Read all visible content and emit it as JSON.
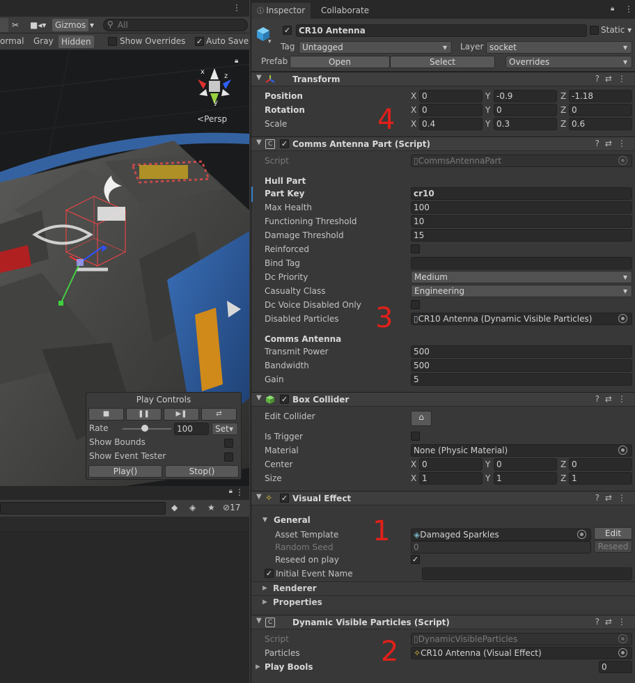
{
  "scene": {
    "gizmos": "Gizmos",
    "search_placeholder": "All",
    "shading": [
      "ormal",
      "Gray",
      "Hidden"
    ],
    "show_overrides": "Show Overrides",
    "auto_save": "Auto Save",
    "persp": "Persp",
    "axes": {
      "x": "x",
      "y": "y",
      "z": "z"
    },
    "hidden_count": "17"
  },
  "play_controls": {
    "title": "Play Controls",
    "rate_label": "Rate",
    "rate_value": "100",
    "set": "Set",
    "show_bounds": "Show Bounds",
    "show_event_tester": "Show Event Tester",
    "play": "Play()",
    "stop": "Stop()",
    "btn_icons": [
      "■",
      "❚❚",
      "▶❚",
      "⇄"
    ]
  },
  "inspector": {
    "tabs": [
      "Inspector",
      "Collaborate"
    ],
    "object_name": "CR10 Antenna",
    "static": "Static",
    "tag_label": "Tag",
    "tag_value": "Untagged",
    "layer_label": "Layer",
    "layer_value": "socket",
    "prefab_label": "Prefab",
    "open": "Open",
    "select": "Select",
    "overrides": "Overrides"
  },
  "transform": {
    "title": "Transform",
    "position_label": "Position",
    "rotation_label": "Rotation",
    "scale_label": "Scale",
    "position": [
      "0",
      "-0.9",
      "-1.18"
    ],
    "rotation": [
      "0",
      "0",
      "0"
    ],
    "scale": [
      "0.4",
      "0.3",
      "0.6"
    ],
    "axes": [
      "X",
      "Y",
      "Z"
    ]
  },
  "comms": {
    "title": "Comms Antenna Part (Script)",
    "script_label": "Script",
    "script_value": "CommsAntennaPart",
    "hull_part": "Hull Part",
    "part_key_label": "Part Key",
    "part_key": "cr10",
    "max_health_label": "Max Health",
    "max_health": "100",
    "functioning_label": "Functioning Threshold",
    "functioning": "10",
    "damage_label": "Damage Threshold",
    "damage": "15",
    "reinforced_label": "Reinforced",
    "bind_tag_label": "Bind Tag",
    "bind_tag": "",
    "dc_priority_label": "Dc Priority",
    "dc_priority": "Medium",
    "casualty_label": "Casualty Class",
    "casualty": "Engineering",
    "dc_voice_label": "Dc Voice Disabled Only",
    "disabled_particles_label": "Disabled Particles",
    "disabled_particles": "CR10 Antenna (Dynamic Visible Particles)",
    "comms_antenna": "Comms Antenna",
    "transmit_label": "Transmit Power",
    "transmit": "500",
    "bandwidth_label": "Bandwidth",
    "bandwidth": "500",
    "gain_label": "Gain",
    "gain": "5"
  },
  "box": {
    "title": "Box Collider",
    "edit_label": "Edit Collider",
    "trigger_label": "Is Trigger",
    "material_label": "Material",
    "material": "None (Physic Material)",
    "center_label": "Center",
    "center": [
      "0",
      "0",
      "0"
    ],
    "size_label": "Size",
    "size": [
      "1",
      "1",
      "1"
    ]
  },
  "vfx": {
    "title": "Visual Effect",
    "general": "General",
    "asset_label": "Asset Template",
    "asset": "Damaged Sparkles",
    "edit": "Edit",
    "seed_label": "Random Seed",
    "seed": "0",
    "reseed": "Reseed",
    "reseed_play_label": "Reseed on play",
    "initial_label": "Initial Event Name",
    "initial": "",
    "renderer": "Renderer",
    "properties": "Properties"
  },
  "dvp": {
    "title": "Dynamic Visible Particles (Script)",
    "script_label": "Script",
    "script_value": "DynamicVisibleParticles",
    "particles_label": "Particles",
    "particles": "CR10 Antenna (Visual Effect)",
    "play_bools_label": "Play Bools",
    "play_bools": "0"
  },
  "annotations": [
    "4",
    "3",
    "1",
    "2"
  ],
  "colors": {
    "accent_red": "#e0201a",
    "field_bg": "#2a2a2a",
    "panel_bg": "#383838"
  }
}
